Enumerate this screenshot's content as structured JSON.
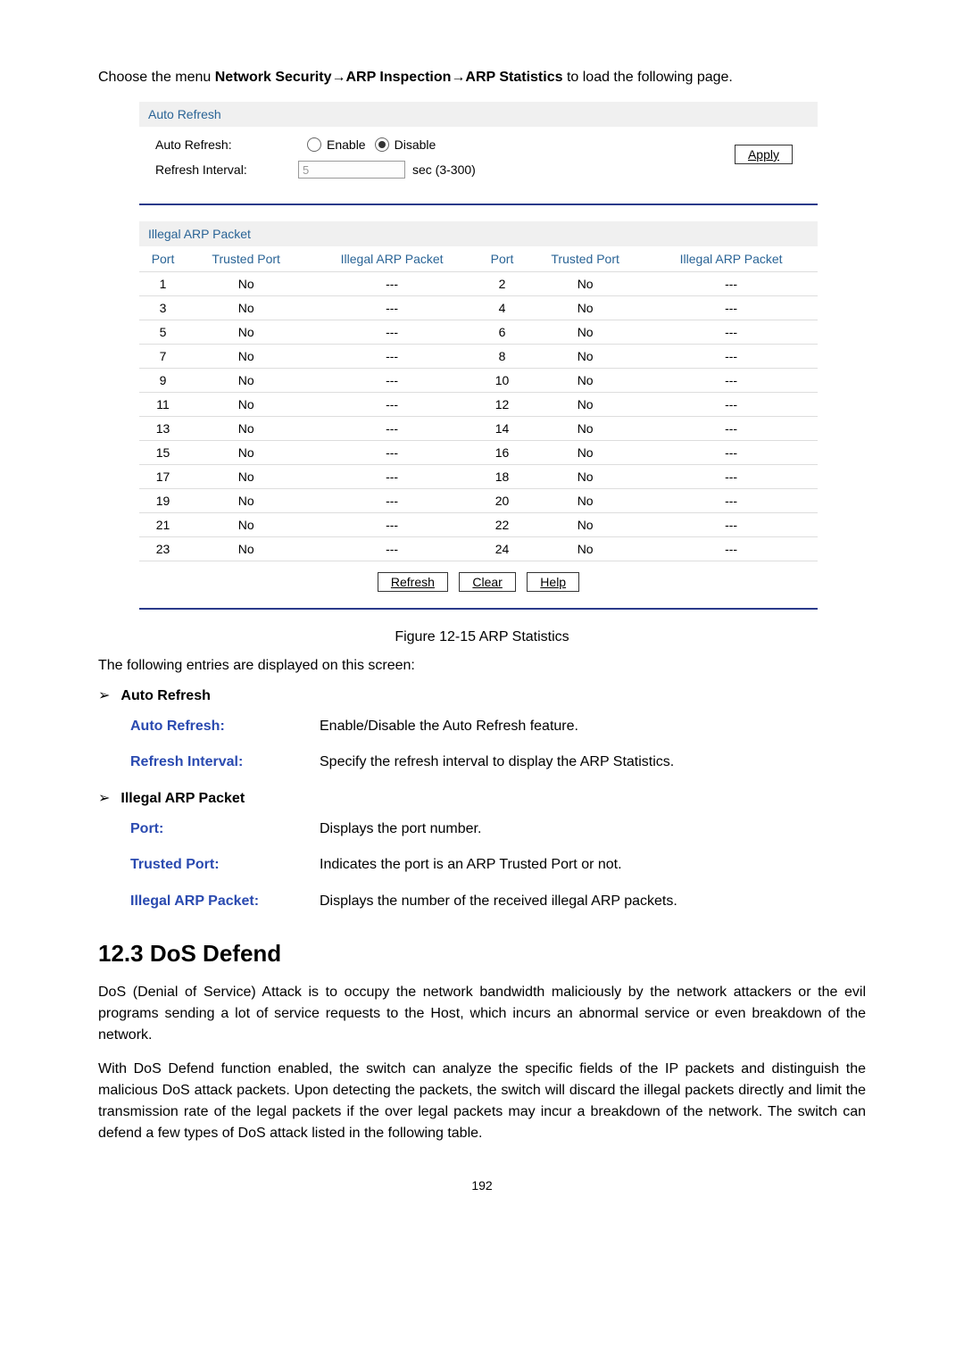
{
  "intro": {
    "prefix": "Choose the menu ",
    "path1": "Network Security",
    "arrow": "→",
    "path2": "ARP Inspection",
    "path3": "ARP Statistics",
    "suffix": " to load the following page."
  },
  "panel": {
    "auto_refresh_section_title": "Auto Refresh",
    "auto_refresh_label": "Auto Refresh:",
    "enable_label": "Enable",
    "disable_label": "Disable",
    "refresh_interval_label": "Refresh Interval:",
    "interval_value": "5",
    "interval_unit": "sec (3-300)",
    "apply_btn": "Apply",
    "illegal_title": "Illegal ARP Packet",
    "columns": {
      "port": "Port",
      "trusted": "Trusted Port",
      "illegal": "Illegal ARP Packet"
    },
    "rows": [
      {
        "p1": "1",
        "t1": "No",
        "i1": "---",
        "p2": "2",
        "t2": "No",
        "i2": "---"
      },
      {
        "p1": "3",
        "t1": "No",
        "i1": "---",
        "p2": "4",
        "t2": "No",
        "i2": "---"
      },
      {
        "p1": "5",
        "t1": "No",
        "i1": "---",
        "p2": "6",
        "t2": "No",
        "i2": "---"
      },
      {
        "p1": "7",
        "t1": "No",
        "i1": "---",
        "p2": "8",
        "t2": "No",
        "i2": "---"
      },
      {
        "p1": "9",
        "t1": "No",
        "i1": "---",
        "p2": "10",
        "t2": "No",
        "i2": "---"
      },
      {
        "p1": "11",
        "t1": "No",
        "i1": "---",
        "p2": "12",
        "t2": "No",
        "i2": "---"
      },
      {
        "p1": "13",
        "t1": "No",
        "i1": "---",
        "p2": "14",
        "t2": "No",
        "i2": "---"
      },
      {
        "p1": "15",
        "t1": "No",
        "i1": "---",
        "p2": "16",
        "t2": "No",
        "i2": "---"
      },
      {
        "p1": "17",
        "t1": "No",
        "i1": "---",
        "p2": "18",
        "t2": "No",
        "i2": "---"
      },
      {
        "p1": "19",
        "t1": "No",
        "i1": "---",
        "p2": "20",
        "t2": "No",
        "i2": "---"
      },
      {
        "p1": "21",
        "t1": "No",
        "i1": "---",
        "p2": "22",
        "t2": "No",
        "i2": "---"
      },
      {
        "p1": "23",
        "t1": "No",
        "i1": "---",
        "p2": "24",
        "t2": "No",
        "i2": "---"
      }
    ],
    "refresh_btn": "Refresh",
    "clear_btn": "Clear",
    "help_btn": "Help"
  },
  "figure_caption": "Figure 12-15 ARP Statistics",
  "entries_intro": "The following entries are displayed on this screen:",
  "sections": {
    "auto_refresh_heading": "Auto Refresh",
    "illegal_heading": "Illegal ARP Packet",
    "defs": {
      "auto_refresh_term": "Auto Refresh:",
      "auto_refresh_desc": "Enable/Disable the Auto Refresh feature.",
      "refresh_interval_term": "Refresh Interval:",
      "refresh_interval_desc": "Specify the refresh interval to display the ARP Statistics.",
      "port_term": "Port:",
      "port_desc": "Displays the port number.",
      "trusted_port_term": "Trusted Port:",
      "trusted_port_desc": "Indicates the port is an ARP Trusted Port or not.",
      "illegal_term": "Illegal ARP Packet:",
      "illegal_desc": "Displays the number of the received illegal ARP packets."
    }
  },
  "dos": {
    "heading": "12.3 DoS Defend",
    "p1": "DoS (Denial of Service) Attack is to occupy the network bandwidth maliciously by the network attackers or the evil programs sending a lot of service requests to the Host, which incurs an abnormal service or even breakdown of the network.",
    "p2": "With DoS Defend function enabled, the switch can analyze the specific fields of the IP packets and distinguish the malicious DoS attack packets. Upon detecting the packets, the switch will discard the illegal packets directly and limit the transmission rate of the legal packets if the over legal packets may incur a breakdown of the network. The switch can defend a few types of DoS attack listed in the following table."
  },
  "page_number": "192"
}
